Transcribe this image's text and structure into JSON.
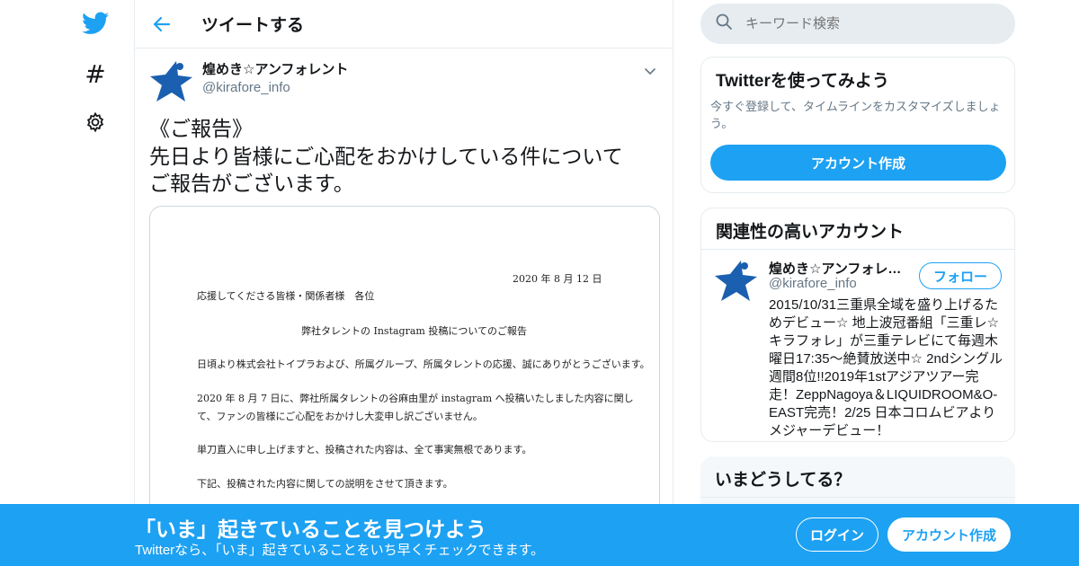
{
  "colors": {
    "accent": "#1da1f2",
    "text": "#14171a",
    "muted": "#657786",
    "border": "#e6ecf0"
  },
  "rail": {
    "icons": [
      "twitter-bird-icon",
      "hashtag-icon",
      "gear-icon"
    ],
    "hash_glyph": "#"
  },
  "header": {
    "title": "ツイートする"
  },
  "tweet": {
    "display_name": "煌めき☆アンフォレント",
    "handle": "@kirafore_info",
    "text": "《ご報告》\n先日より皆様にご心配をおかけしている件について\nご報告がございます。",
    "document": {
      "date": "2020 年 8 月 12 日",
      "addressee": "応援してくださる皆様・関係者様　各位",
      "title": "弊社タレントの Instagram 投稿についてのご報告",
      "p1": "日頃より株式会社トイプラおよび、所属グループ、所属タレントの応援、誠にありがとうございます。",
      "p2a": "2020 年 8 月 7 日に、弊社所属タレントの谷麻由里が instagram へ投稿いたしました内容に関し",
      "p2b": "て、ファンの皆様にご心配をおかけし大変申し訳ございません。",
      "p3": "単刀直入に申し上げますと、投稿された内容は、全て事実無根であります。",
      "p4": "下記、投稿された内容に関しての説明をさせて頂きます。"
    }
  },
  "search": {
    "placeholder": "キーワード検索"
  },
  "signup_card": {
    "title": "Twitterを使ってみよう",
    "subtitle": "今すぐ登録して、タイムラインをカスタマイズしましょう。",
    "button": "アカウント作成"
  },
  "related": {
    "title": "関連性の高いアカウント",
    "name": "煌めき☆アンフォレ…",
    "handle": "@kirafore_info",
    "follow": "フォロー",
    "bio": "2015/10/31三重県全域を盛り上げるためデビュー☆ 地上波冠番組「三重レ☆キラフォレ」が三重テレビにて毎週木曜日17:35〜絶賛放送中☆ 2ndシングル週間8位!!2019年1stアジアツアー完走！ZeppNagoya＆LIQUIDROOM&O-EAST完売！2/25 日本コロムビアよりメジャーデビュー！"
  },
  "trends": {
    "title": "いまどうしてる？"
  },
  "bottom_bar": {
    "title": "「いま」起きていることを見つけよう",
    "subtitle": "Twitterなら、「いま」起きていることをいち早くチェックできます。",
    "login": "ログイン",
    "signup": "アカウント作成"
  }
}
